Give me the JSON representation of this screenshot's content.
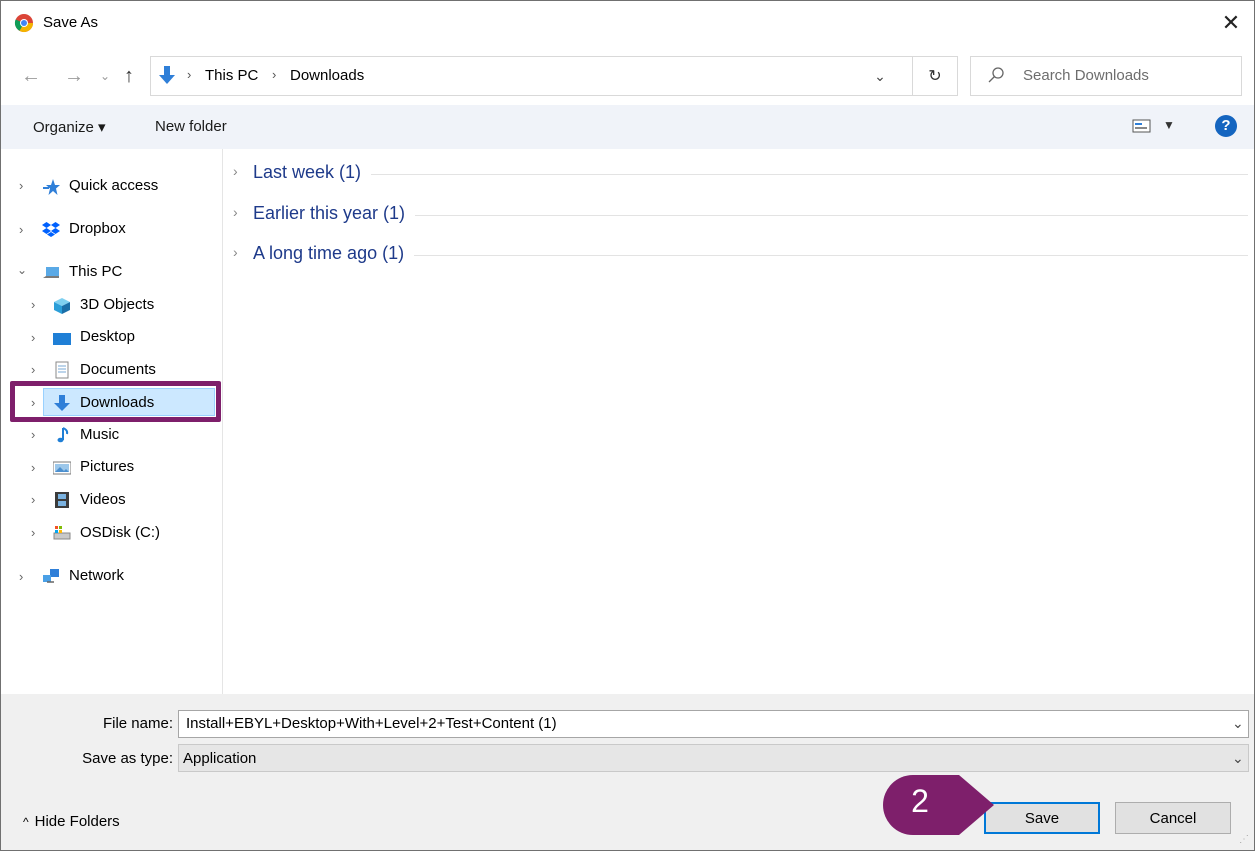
{
  "window": {
    "title": "Save As"
  },
  "address": {
    "segments": [
      "This PC",
      "Downloads"
    ],
    "search_placeholder": "Search Downloads"
  },
  "toolbar": {
    "organize_label": "Organize ▾",
    "new_folder_label": "New folder",
    "help_label": "?"
  },
  "nav": {
    "items": [
      {
        "label": "Quick access",
        "icon": "star-icon"
      },
      {
        "label": "Dropbox",
        "icon": "dropbox-icon"
      },
      {
        "label": "This PC",
        "icon": "computer-icon"
      },
      {
        "label": "3D Objects",
        "icon": "cube-icon"
      },
      {
        "label": "Desktop",
        "icon": "desktop-icon"
      },
      {
        "label": "Documents",
        "icon": "documents-icon"
      },
      {
        "label": "Downloads",
        "icon": "download-arrow-icon"
      },
      {
        "label": "Music",
        "icon": "music-note-icon"
      },
      {
        "label": "Pictures",
        "icon": "pictures-icon"
      },
      {
        "label": "Videos",
        "icon": "film-icon"
      },
      {
        "label": "OSDisk (C:)",
        "icon": "disk-drive-icon"
      },
      {
        "label": "Network",
        "icon": "network-icon"
      }
    ]
  },
  "groups": [
    {
      "label": "Last week (1)"
    },
    {
      "label": "Earlier this year (1)"
    },
    {
      "label": "A long time ago (1)"
    }
  ],
  "form": {
    "file_name_label": "File name:",
    "file_name_value": "Install+EBYL+Desktop+With+Level+2+Test+Content (1)",
    "save_type_label": "Save as type:",
    "save_type_value": "Application"
  },
  "buttons": {
    "hide_folders": "Hide Folders",
    "save": "Save",
    "cancel": "Cancel"
  },
  "annotation": {
    "step_number": "2",
    "color": "#7e1f6b"
  },
  "colors": {
    "selection": "#cce8ff",
    "toolbar_bg": "#f0f3f9",
    "accent": "#0078d7"
  }
}
